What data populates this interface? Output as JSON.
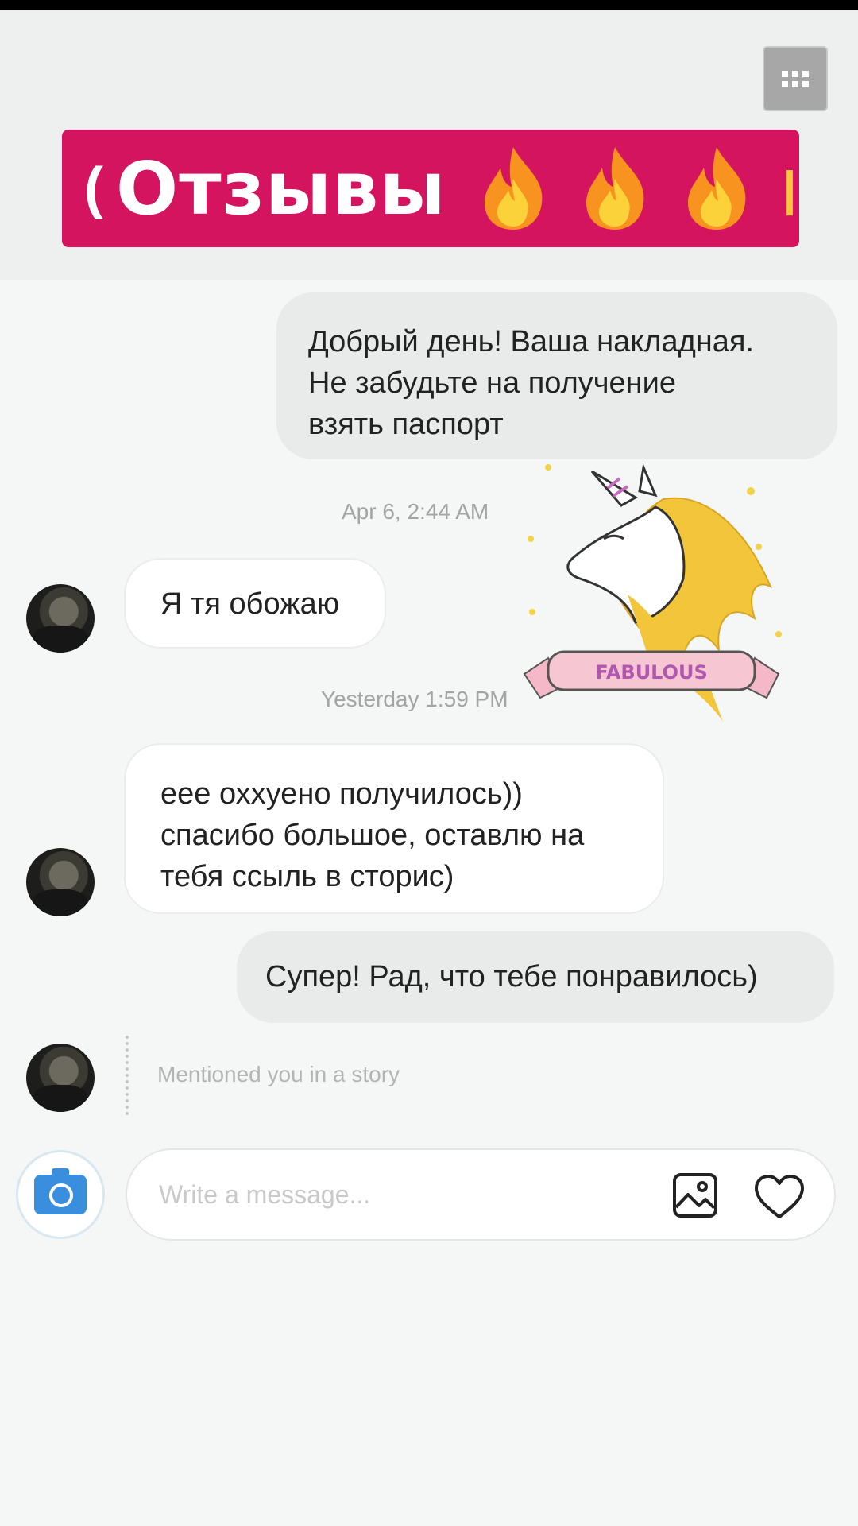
{
  "banner": {
    "left_paren": "(",
    "title": "Отзывы",
    "flame_count": 3,
    "bg_color": "#d4145e"
  },
  "messages": [
    {
      "direction": "outgoing",
      "text_lines": [
        "Добрый день! Ваша накладная.",
        "Не забудьте на получение",
        "взять паспорт"
      ]
    },
    {
      "direction": "incoming",
      "text_lines": [
        "Я тя обожаю"
      ]
    },
    {
      "direction": "incoming",
      "text_lines": [
        "еее оххуено получилось))",
        "спасибо большое, оставлю на",
        "тебя ссыль в сторис)"
      ]
    },
    {
      "direction": "outgoing",
      "text_lines": [
        "Супер! Рад, что тебе понравилось)"
      ]
    }
  ],
  "timestamps": [
    "Apr 6, 2:44 AM",
    "Yesterday 1:59 PM"
  ],
  "story_mention": "Mentioned you in a story",
  "sticker": {
    "label": "FABULOUS"
  },
  "composer": {
    "placeholder": "Write a message...",
    "camera_icon": "camera-icon",
    "gallery_icon": "gallery-icon",
    "like_icon": "heart-icon"
  },
  "colors": {
    "camera_blue": "#3a8ede",
    "banner": "#d4145e"
  }
}
